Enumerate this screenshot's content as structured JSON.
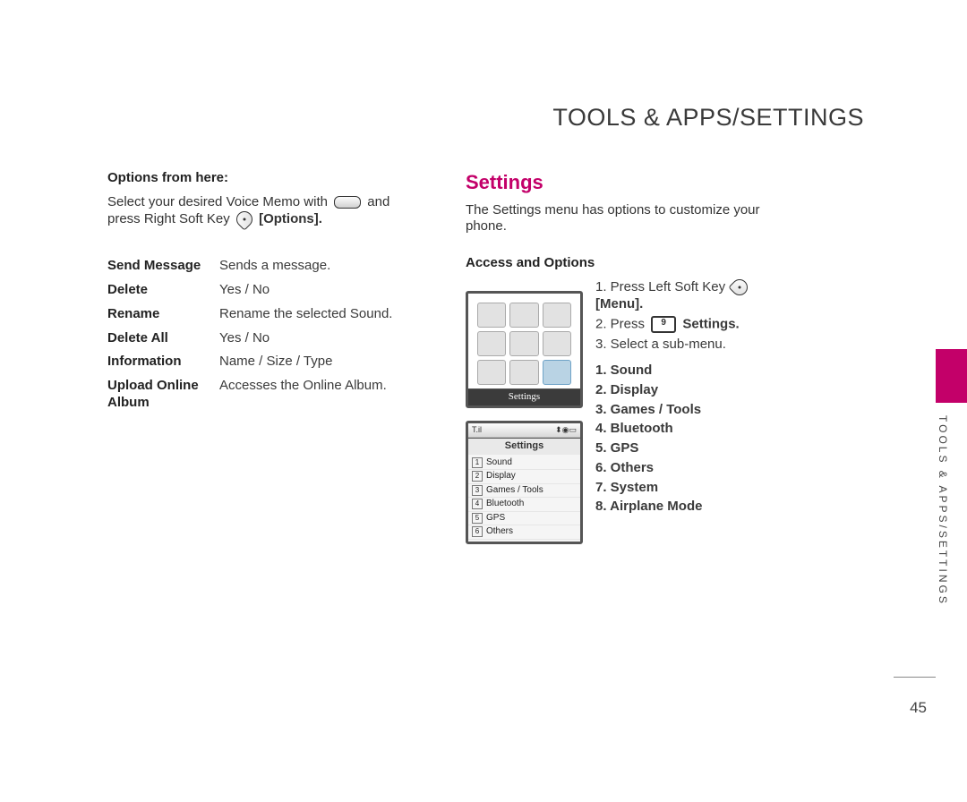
{
  "header": {
    "title": "TOOLS & APPS/SETTINGS"
  },
  "left": {
    "heading": "Options from here:",
    "intro_a": "Select your desired Voice Memo with",
    "intro_b": "and press Right Soft Key",
    "intro_c": "[Options].",
    "options": [
      {
        "k": "Send Message",
        "v": "Sends a message."
      },
      {
        "k": "Delete",
        "v": "Yes / No"
      },
      {
        "k": "Rename",
        "v": "Rename the selected Sound."
      },
      {
        "k": "Delete All",
        "v": "Yes / No"
      },
      {
        "k": "Information",
        "v": "Name / Size / Type"
      },
      {
        "k": "Upload Online Album",
        "v": "Accesses the Online Album."
      }
    ]
  },
  "right": {
    "title": "Settings",
    "desc": "The Settings menu has options to customize your phone.",
    "access_heading": "Access and Options",
    "steps": {
      "s1a": "1. Press Left Soft Key",
      "s1b": "[Menu].",
      "s2a": "2. Press",
      "s2_key": "9",
      "s2b": "Settings.",
      "s3": "3. Select a sub-menu."
    },
    "submenu": [
      "1. Sound",
      "2. Display",
      "3. Games / Tools",
      "4. Bluetooth",
      "5. GPS",
      "6. Others",
      "7. System",
      "8. Airplane Mode"
    ],
    "thumb1_caption": "Settings",
    "thumb2_title": "Settings",
    "thumb2_items": [
      "Sound",
      "Display",
      "Games / Tools",
      "Bluetooth",
      "GPS",
      "Others"
    ],
    "thumb2_status_left": "T.il",
    "thumb2_status_right": "⬍◉▭"
  },
  "side": {
    "label": "TOOLS & APPS/SETTINGS"
  },
  "page_number": "45",
  "icons": {
    "center_key": "center-key-icon",
    "right_soft": "right-soft-key-icon",
    "left_soft": "left-soft-key-icon",
    "nine_key": "key-9-icon"
  }
}
